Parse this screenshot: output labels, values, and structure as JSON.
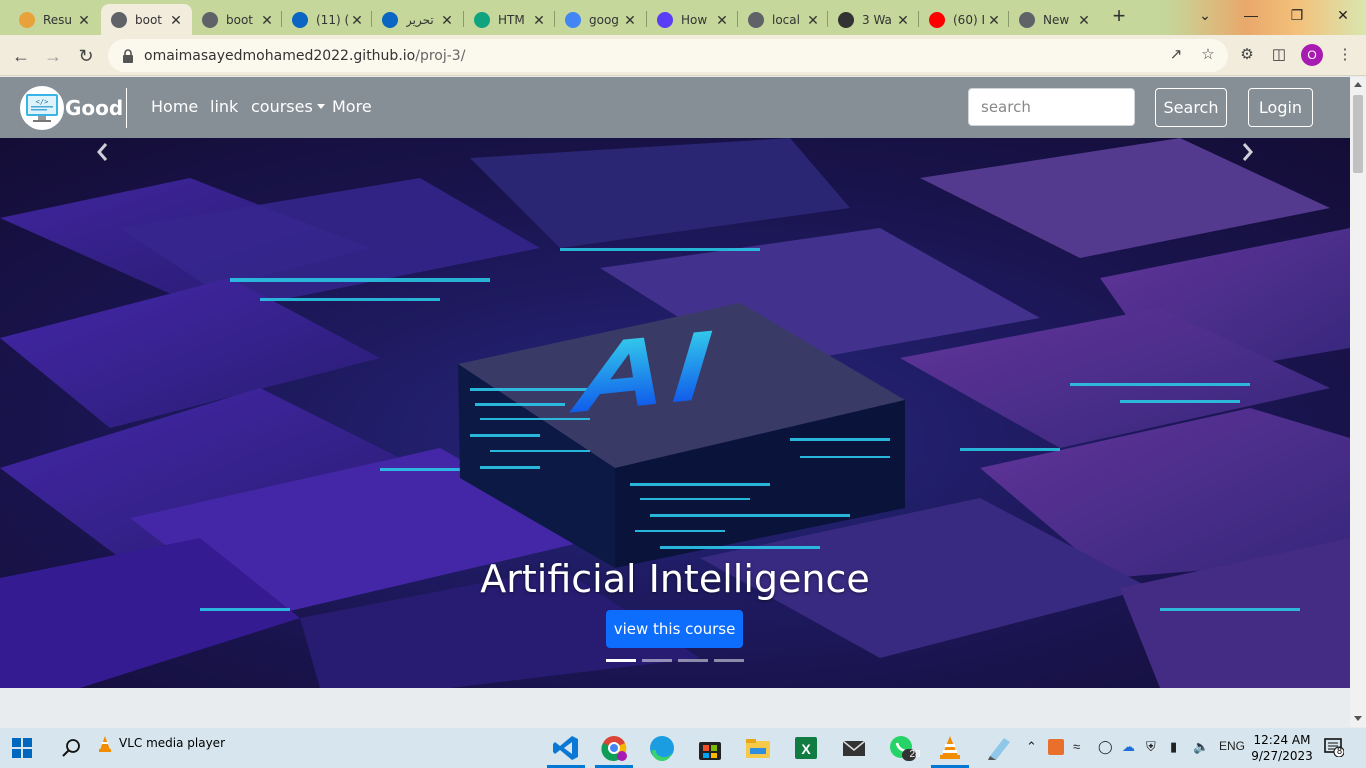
{
  "browser": {
    "tabs": [
      {
        "label": "Resu",
        "icon": "resume-favicon-icon",
        "color": "#e9a23b"
      },
      {
        "label": "boot",
        "icon": "globe-icon",
        "color": "#5f6368",
        "active": true
      },
      {
        "label": "boot",
        "icon": "globe-icon",
        "color": "#5f6368"
      },
      {
        "label": "(11) (",
        "icon": "linkedin-icon",
        "color": "#0a66c2"
      },
      {
        "label": "تحرير",
        "icon": "linkedin-icon",
        "color": "#0a66c2"
      },
      {
        "label": "HTM",
        "icon": "chatgpt-icon",
        "color": "#10a37f"
      },
      {
        "label": "goog",
        "icon": "google-icon",
        "color": "#4285f4"
      },
      {
        "label": "How",
        "icon": "arc-icon",
        "color": "#5b3df5"
      },
      {
        "label": "local",
        "icon": "globe-icon",
        "color": "#5f6368"
      },
      {
        "label": "3 Wa",
        "icon": "x-circle-icon",
        "color": "#333333"
      },
      {
        "label": "(60) I",
        "icon": "youtube-icon",
        "color": "#ff0000"
      },
      {
        "label": "New",
        "icon": "chrome-icon",
        "color": "#5f6368"
      }
    ],
    "new_tab": "+",
    "url_host": "omaimasayedmohamed2022.github.io",
    "url_path": "/proj-3/",
    "profile_initial": "O"
  },
  "navbar": {
    "brand": "Good",
    "links": [
      "Home",
      "link",
      "courses",
      "More"
    ],
    "search_placeholder": "search",
    "search_button": "Search",
    "login_button": "Login"
  },
  "carousel": {
    "image_text": "AI",
    "caption_title": "Artificial Intelligence",
    "caption_button": "view this course",
    "indicators": 4,
    "active_indicator": 0
  },
  "taskbar": {
    "vlc_label": "VLC media player",
    "whatsapp_badge": "28",
    "language": "ENG",
    "time": "12:24 AM",
    "date": "9/27/2023",
    "notification_count": "8"
  }
}
